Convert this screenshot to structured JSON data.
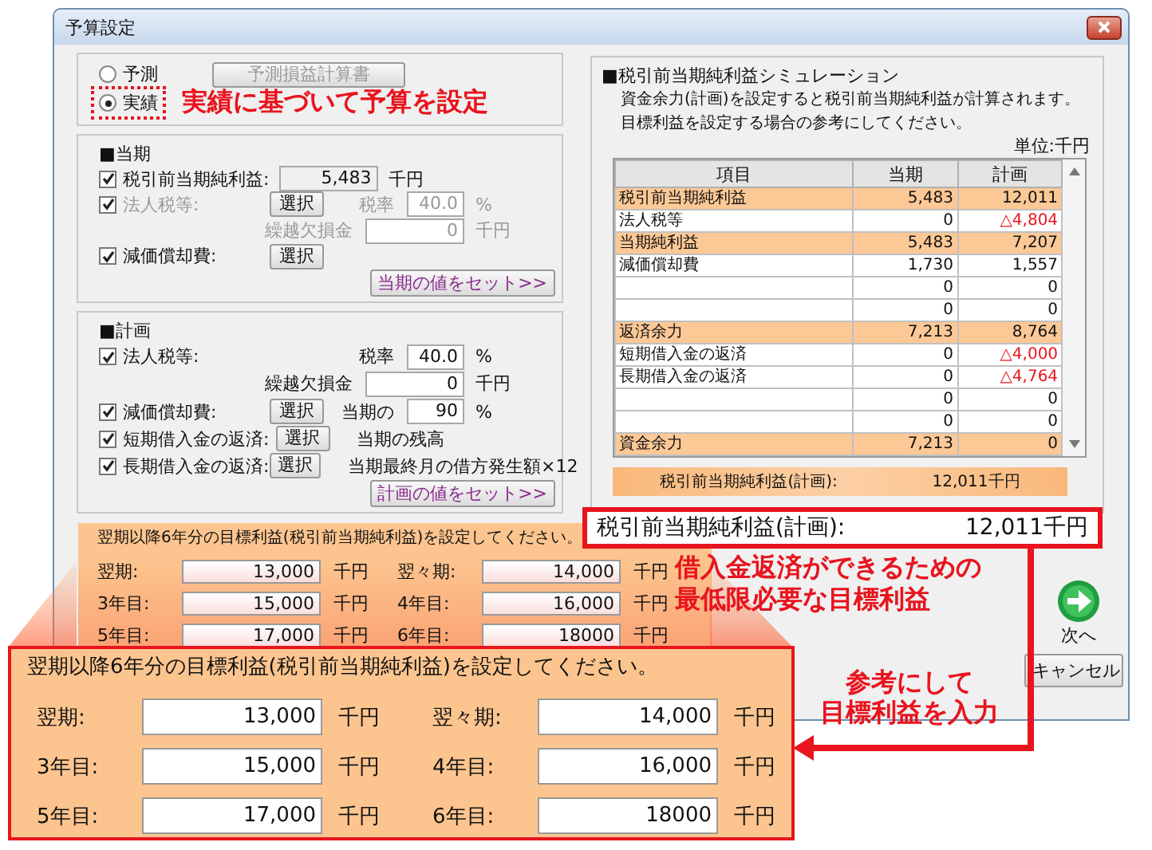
{
  "window": {
    "title": "予算設定"
  },
  "mode": {
    "options": [
      {
        "label": "予測",
        "selected": false
      },
      {
        "label": "実績",
        "selected": true
      }
    ],
    "calc_button": {
      "label": "予測損益計算書",
      "disabled": true
    },
    "note": "実績に基づいて予算を設定"
  },
  "current": {
    "heading": "■当期",
    "profit": {
      "label": "税引前当期純利益:",
      "checked": true,
      "value": "5,483",
      "unit": "千円"
    },
    "tax": {
      "label": "法人税等:",
      "checked": true,
      "button": "選択",
      "rate_label": "税率",
      "rate": "40.0",
      "rate_unit": "%",
      "loss_label": "繰越欠損金",
      "loss": "0",
      "loss_unit": "千円",
      "disabled": true
    },
    "depreciation": {
      "label": "減価償却費:",
      "checked": true,
      "button": "選択"
    },
    "set_button": "当期の値をセット>>"
  },
  "plan": {
    "heading": "■計画",
    "tax": {
      "label": "法人税等:",
      "checked": true,
      "rate_label": "税率",
      "rate": "40.0",
      "rate_unit": "%",
      "loss_label": "繰越欠損金",
      "loss": "0",
      "loss_unit": "千円"
    },
    "depreciation": {
      "label": "減価償却費:",
      "checked": true,
      "button": "選択",
      "ratio_label": "当期の",
      "ratio": "90",
      "ratio_unit": "%"
    },
    "short_loan": {
      "label": "短期借入金の返済:",
      "checked": true,
      "button": "選択",
      "note": "当期の残高"
    },
    "long_loan": {
      "label": "長期借入金の返済:",
      "checked": true,
      "button": "選択",
      "note": "当期最終月の借方発生額×12"
    },
    "set_button": "計画の値をセット>>"
  },
  "simulation": {
    "heading": "■税引前当期純利益シミュレーション",
    "description": [
      "資金余力(計画)を設定すると税引前当期純利益が計算されます。",
      "目標利益を設定する場合の参考にしてください。"
    ],
    "unit_label": "単位:千円",
    "columns": [
      "項目",
      "当期",
      "計画"
    ],
    "rows": [
      {
        "item": "税引前当期純利益",
        "current": "5,483",
        "plan": "12,011",
        "highlight": true,
        "negative": false
      },
      {
        "item": "法人税等",
        "current": "0",
        "plan": "△4,804",
        "highlight": false,
        "negative": true
      },
      {
        "item": "当期純利益",
        "current": "5,483",
        "plan": "7,207",
        "highlight": true,
        "negative": false
      },
      {
        "item": "減価償却費",
        "current": "1,730",
        "plan": "1,557",
        "highlight": false,
        "negative": false
      },
      {
        "current": "0",
        "plan": "0",
        "highlight": false,
        "negative": false
      },
      {
        "current": "0",
        "plan": "0",
        "highlight": false,
        "negative": false
      },
      {
        "item": "返済余力",
        "current": "7,213",
        "plan": "8,764",
        "highlight": true,
        "negative": false
      },
      {
        "item": "短期借入金の返済",
        "current": "0",
        "plan": "△4,000",
        "highlight": false,
        "negative": true
      },
      {
        "item": "長期借入金の返済",
        "current": "0",
        "plan": "△4,764",
        "highlight": false,
        "negative": true
      },
      {
        "current": "0",
        "plan": "0",
        "highlight": false,
        "negative": false
      },
      {
        "current": "0",
        "plan": "0",
        "highlight": false,
        "negative": false
      },
      {
        "item": "資金余力",
        "current": "7,213",
        "plan": "0",
        "highlight": true,
        "negative": false
      }
    ],
    "summary": {
      "label": "税引前当期純利益(計画):",
      "value": "12,011千円"
    }
  },
  "targets": {
    "prompt": "翌期以降6年分の目標利益(税引前当期純利益)を設定してください。",
    "items": [
      {
        "label": "翌期:",
        "value": "13,000",
        "unit": "千円"
      },
      {
        "label": "翌々期:",
        "value": "14,000",
        "unit": "千円"
      },
      {
        "label": "3年目:",
        "value": "15,000",
        "unit": "千円"
      },
      {
        "label": "4年目:",
        "value": "16,000",
        "unit": "千円"
      },
      {
        "label": "5年目:",
        "value": "17,000",
        "unit": "千円"
      },
      {
        "label": "6年目:",
        "value": "18000",
        "unit": "千円"
      }
    ]
  },
  "buttons": {
    "next": "次へ",
    "cancel": "キャンセル"
  },
  "callouts": {
    "profit": {
      "label": "税引前当期純利益(計画):",
      "value": "12,011千円"
    },
    "minimum_note": [
      "借入金返済ができるための",
      "最低限必要な目標利益"
    ],
    "input_note": [
      "参考にして",
      "目標利益を入力"
    ]
  },
  "zoomed_targets": {
    "prompt": "翌期以降6年分の目標利益(税引前当期純利益)を設定してください。",
    "items": [
      {
        "label": "翌期:",
        "value": "13,000",
        "unit": "千円"
      },
      {
        "label": "翌々期:",
        "value": "14,000",
        "unit": "千円"
      },
      {
        "label": "3年目:",
        "value": "15,000",
        "unit": "千円"
      },
      {
        "label": "4年目:",
        "value": "16,000",
        "unit": "千円"
      },
      {
        "label": "5年目:",
        "value": "17,000",
        "unit": "千円"
      },
      {
        "label": "6年目:",
        "value": "18000",
        "unit": "千円"
      }
    ]
  }
}
